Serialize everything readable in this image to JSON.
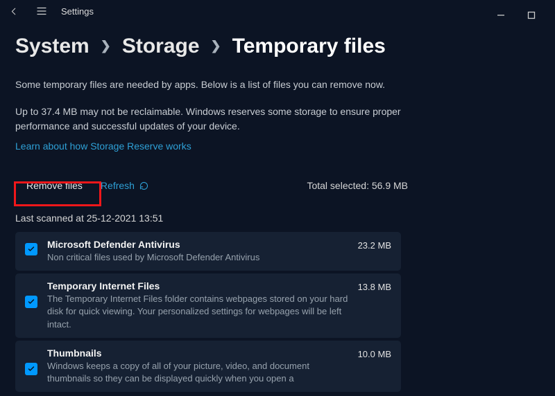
{
  "app": {
    "title": "Settings"
  },
  "breadcrumb": [
    "System",
    "Storage",
    "Temporary files"
  ],
  "description_1": "Some temporary files are needed by apps. Below is a list of files you can remove now.",
  "description_2": "Up to 37.4 MB may not be reclaimable. Windows reserves some storage to ensure proper performance and successful updates of your device.",
  "learn_link": "Learn about how Storage Reserve works",
  "actions": {
    "remove_label": "Remove files",
    "refresh_label": "Refresh",
    "total_label": "Total selected: 56.9 MB"
  },
  "last_scanned_label": "Last scanned at 25-12-2021 13:51",
  "items": [
    {
      "title": "Microsoft Defender Antivirus",
      "sub": "Non critical files used by Microsoft Defender Antivirus",
      "size": "23.2 MB",
      "checked": true
    },
    {
      "title": "Temporary Internet Files",
      "sub": "The Temporary Internet Files folder contains webpages stored on your hard disk for quick viewing. Your personalized settings for webpages will be left intact.",
      "size": "13.8 MB",
      "checked": true
    },
    {
      "title": "Thumbnails",
      "sub": "Windows keeps a copy of all of your picture, video, and document thumbnails so they can be displayed quickly when you open a",
      "size": "10.0 MB",
      "checked": true
    }
  ]
}
